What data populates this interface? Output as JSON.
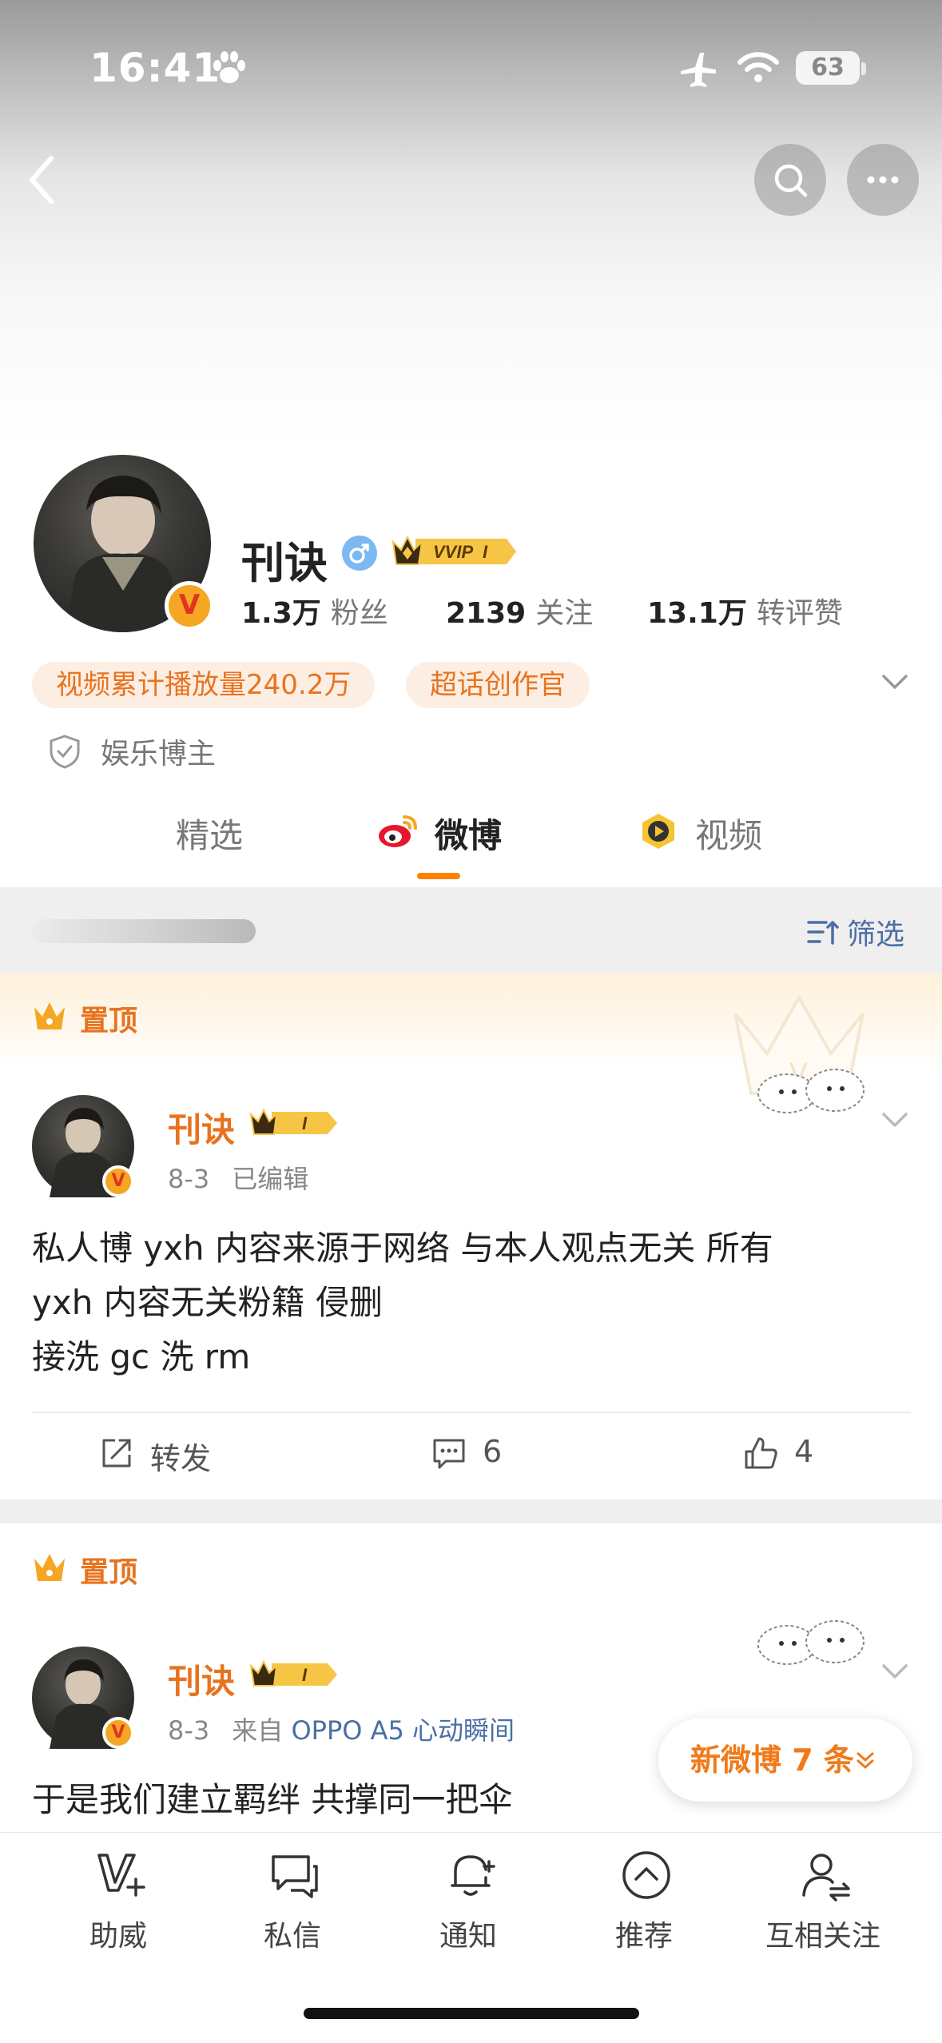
{
  "status_bar": {
    "time": "16:41",
    "battery": "63"
  },
  "profile": {
    "name": "刊诀",
    "vip_label": "VVIP",
    "vip_level": "I",
    "stats": [
      {
        "value": "1.3万",
        "label": "粉丝"
      },
      {
        "value": "2139",
        "label": "关注"
      },
      {
        "value": "13.1万",
        "label": "转评赞"
      }
    ],
    "tags": [
      "视频累计播放量240.2万",
      "超话创作官"
    ],
    "category": "娱乐博主"
  },
  "tabs": [
    {
      "label": "精选",
      "active": false
    },
    {
      "label": "微博",
      "active": true
    },
    {
      "label": "视频",
      "active": false
    }
  ],
  "filter": {
    "label": "筛选"
  },
  "pinned_label": "置顶",
  "posts": [
    {
      "author": "刊诀",
      "vip_level": "I",
      "date": "8-3",
      "meta_extra": "已编辑",
      "lines": [
        "私人博 yxh 内容来源于网络 与本人观点无关 所有",
        "yxh 内容无关粉籍 侵删",
        "接洗 gc 洗 rm"
      ],
      "actions": {
        "repost": "转发",
        "comments": "6",
        "likes": "4"
      }
    },
    {
      "author": "刊诀",
      "vip_level": "I",
      "date": "8-3",
      "source_prefix": "来自",
      "source": "OPPO A5 心动瞬间",
      "lines": [
        "于是我们建立羁绊 共撑同一把伞"
      ]
    }
  ],
  "new_posts": {
    "label": "新微博 7 条"
  },
  "bottom_nav": [
    {
      "label": "助威",
      "icon": "cheer-icon"
    },
    {
      "label": "私信",
      "icon": "message-icon"
    },
    {
      "label": "通知",
      "icon": "bell-icon"
    },
    {
      "label": "推荐",
      "icon": "recommend-icon"
    },
    {
      "label": "互相关注",
      "icon": "mutual-follow-icon"
    }
  ],
  "colors": {
    "accent": "#ff8200",
    "orange_text": "#e8731f",
    "link": "#4a6fa5"
  }
}
